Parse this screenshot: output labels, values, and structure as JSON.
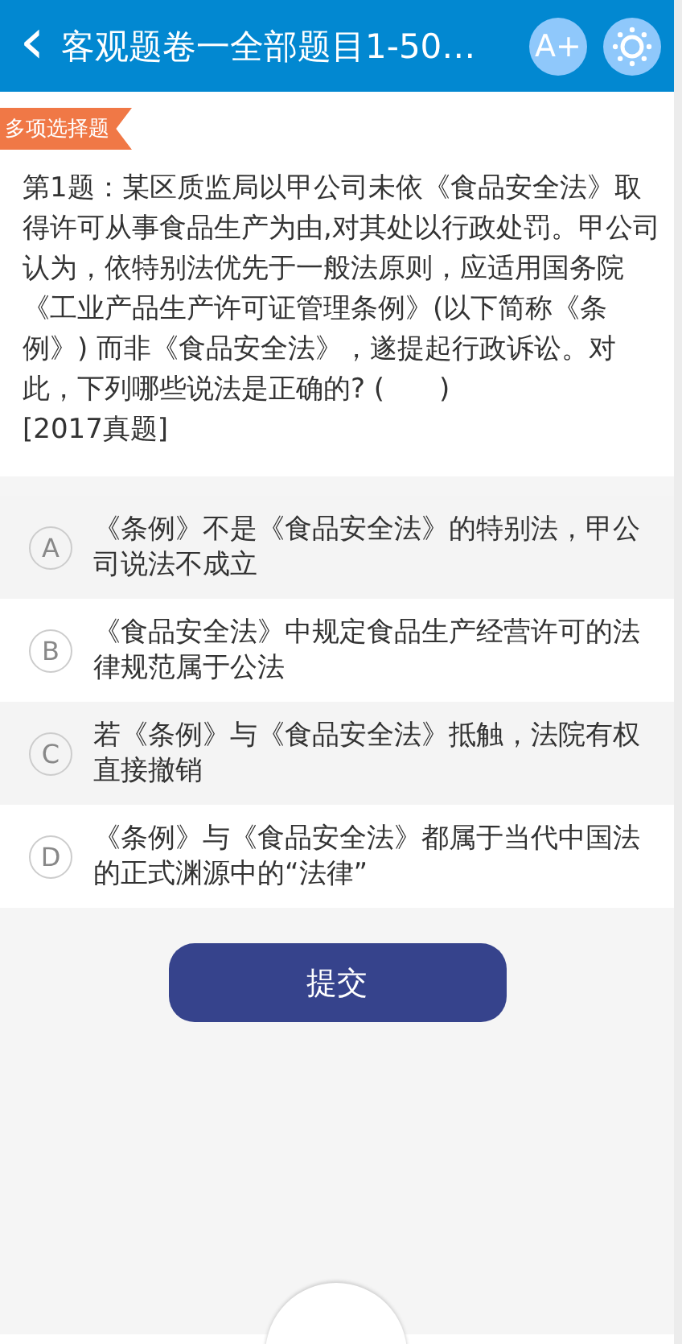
{
  "header": {
    "back_icon": "‹",
    "title": "客观题卷一全部题目1-50…",
    "font_button": "A+"
  },
  "question": {
    "type_badge": "多项选择题",
    "text": "第1题：某区质监局以甲公司未依《食品安全法》取得许可从事食品生产为由,对其处以行政处罚。甲公司认为，依特别法优先于一般法原则，应适用国务院《工业产品生产许可证管理条例》(以下简称《条例》) 而非《食品安全法》，遂提起行政诉讼。对此，下列哪些说法是正确的? (　　)\n[2017真题]"
  },
  "options": [
    {
      "letter": "A",
      "text": "《条例》不是《食品安全法》的特别法，甲公司说法不成立"
    },
    {
      "letter": "B",
      "text": "《食品安全法》中规定食品生产经营许可的法律规范属于公法"
    },
    {
      "letter": "C",
      "text": "若《条例》与《食品安全法》抵触，法院有权直接撤销"
    },
    {
      "letter": "D",
      "text": "《条例》与《食品安全法》都属于当代中国法的正式渊源中的“法律”"
    }
  ],
  "submit_button": "提交"
}
